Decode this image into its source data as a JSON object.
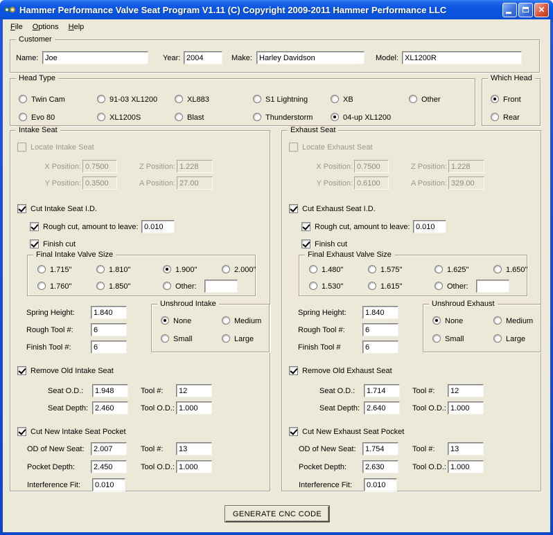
{
  "window": {
    "title": "Hammer Performance Valve Seat Program V1.11 (C) Copyright 2009-2011 Hammer Performance LLC",
    "menu": {
      "file": "File",
      "options": "Options",
      "help": "Help"
    }
  },
  "customer": {
    "legend": "Customer",
    "name_label": "Name:",
    "name_value": "Joe",
    "year_label": "Year:",
    "year_value": "2004",
    "make_label": "Make:",
    "make_value": "Harley Davidson",
    "model_label": "Model:",
    "model_value": "XL1200R"
  },
  "head_type": {
    "legend": "Head Type",
    "row1": [
      "Twin Cam",
      "91-03 XL1200",
      "XL883",
      "S1 Lightning",
      "XB",
      "Other"
    ],
    "row2": [
      "Evo 80",
      "XL1200S",
      "Blast",
      "Thunderstorm",
      "04-up XL1200"
    ],
    "selected": "04-up XL1200"
  },
  "which_head": {
    "legend": "Which Head",
    "options": [
      "Front",
      "Rear"
    ],
    "selected": "Front"
  },
  "intake": {
    "legend": "Intake Seat",
    "locate": {
      "checkbox_label": "Locate Intake Seat",
      "checked": false,
      "enabled": false,
      "x_label": "X Position:",
      "x_value": "0.7500",
      "z_label": "Z Position:",
      "z_value": "1.228",
      "y_label": "Y Position:",
      "y_value": "0.3500",
      "a_label": "A Position:",
      "a_value": "27.00"
    },
    "cut_seat_id": {
      "checkbox_label": "Cut Intake Seat I.D.",
      "checked": true,
      "rough_cut_label": "Rough cut, amount to leave:",
      "rough_cut_checked": true,
      "rough_cut_value": "0.010",
      "finish_cut_label": "Finish cut",
      "finish_cut_checked": true
    },
    "valve_size": {
      "legend": "Final Intake Valve Size",
      "row1": [
        "1.715\"",
        "1.810\"",
        "1.900\"",
        "2.000\""
      ],
      "row2": [
        "1.760\"",
        "1.850\""
      ],
      "other_label": "Other:",
      "other_value": "",
      "selected": "1.900\""
    },
    "spring_height_label": "Spring Height:",
    "spring_height_value": "1.840",
    "rough_tool_label": "Rough Tool #:",
    "rough_tool_value": "6",
    "finish_tool_label": "Finish Tool #:",
    "finish_tool_value": "6",
    "unshroud": {
      "legend": "Unshroud Intake",
      "options": [
        "None",
        "Medium",
        "Small",
        "Large"
      ],
      "selected": "None"
    },
    "remove_old": {
      "checkbox_label": "Remove Old Intake Seat",
      "checked": true,
      "seat_od_label": "Seat O.D.:",
      "seat_od_value": "1.948",
      "tool_num_label": "Tool #:",
      "tool_num_value": "12",
      "seat_depth_label": "Seat Depth:",
      "seat_depth_value": "2.460",
      "tool_od_label": "Tool O.D.:",
      "tool_od_value": "1.000"
    },
    "new_pocket": {
      "checkbox_label": "Cut New Intake Seat Pocket",
      "checked": true,
      "od_label": "OD of New Seat:",
      "od_value": "2.007",
      "tool_num_label": "Tool #:",
      "tool_num_value": "13",
      "depth_label": "Pocket Depth:",
      "depth_value": "2.450",
      "tool_od_label": "Tool O.D.:",
      "tool_od_value": "1.000",
      "fit_label": "Interference Fit:",
      "fit_value": "0.010"
    }
  },
  "exhaust": {
    "legend": "Exhaust Seat",
    "locate": {
      "checkbox_label": "Locate Exhaust Seat",
      "checked": false,
      "enabled": false,
      "x_label": "X Position:",
      "x_value": "0.7500",
      "z_label": "Z Position:",
      "z_value": "1.228",
      "y_label": "Y Position:",
      "y_value": "0.6100",
      "a_label": "A Position:",
      "a_value": "329.00"
    },
    "cut_seat_id": {
      "checkbox_label": "Cut Exhaust Seat I.D.",
      "checked": true,
      "rough_cut_label": "Rough cut, amount to leave:",
      "rough_cut_checked": true,
      "rough_cut_value": "0.010",
      "finish_cut_label": "Finish cut",
      "finish_cut_checked": true
    },
    "valve_size": {
      "legend": "Final Exhaust Valve Size",
      "row1": [
        "1.480\"",
        "1.575\"",
        "1.625\"",
        "1.650\""
      ],
      "row2": [
        "1.530\"",
        "1.615\""
      ],
      "other_label": "Other:",
      "other_value": "",
      "selected": ""
    },
    "spring_height_label": "Spring Height:",
    "spring_height_value": "1.840",
    "rough_tool_label": "Rough Tool #:",
    "rough_tool_value": "6",
    "finish_tool_label": "Finish Tool #",
    "finish_tool_value": "6",
    "unshroud": {
      "legend": "Unshroud Exhaust",
      "options": [
        "None",
        "Medium",
        "Small",
        "Large"
      ],
      "selected": "None"
    },
    "remove_old": {
      "checkbox_label": "Remove Old Exhaust Seat",
      "checked": true,
      "seat_od_label": "Seat O.D.:",
      "seat_od_value": "1.714",
      "tool_num_label": "Tool #:",
      "tool_num_value": "12",
      "seat_depth_label": "Seat Depth:",
      "seat_depth_value": "2.640",
      "tool_od_label": "Tool O.D.:",
      "tool_od_value": "1.000"
    },
    "new_pocket": {
      "checkbox_label": "Cut New Exhaust Seat Pocket",
      "checked": true,
      "od_label": "OD of New Seat:",
      "od_value": "1.754",
      "tool_num_label": "Tool #:",
      "tool_num_value": "13",
      "depth_label": "Pocket Depth:",
      "depth_value": "2.630",
      "tool_od_label": "Tool O.D.:",
      "tool_od_value": "1.000",
      "fit_label": "Interference Fit:",
      "fit_value": "0.010"
    }
  },
  "generate_button_label": "GENERATE CNC CODE"
}
